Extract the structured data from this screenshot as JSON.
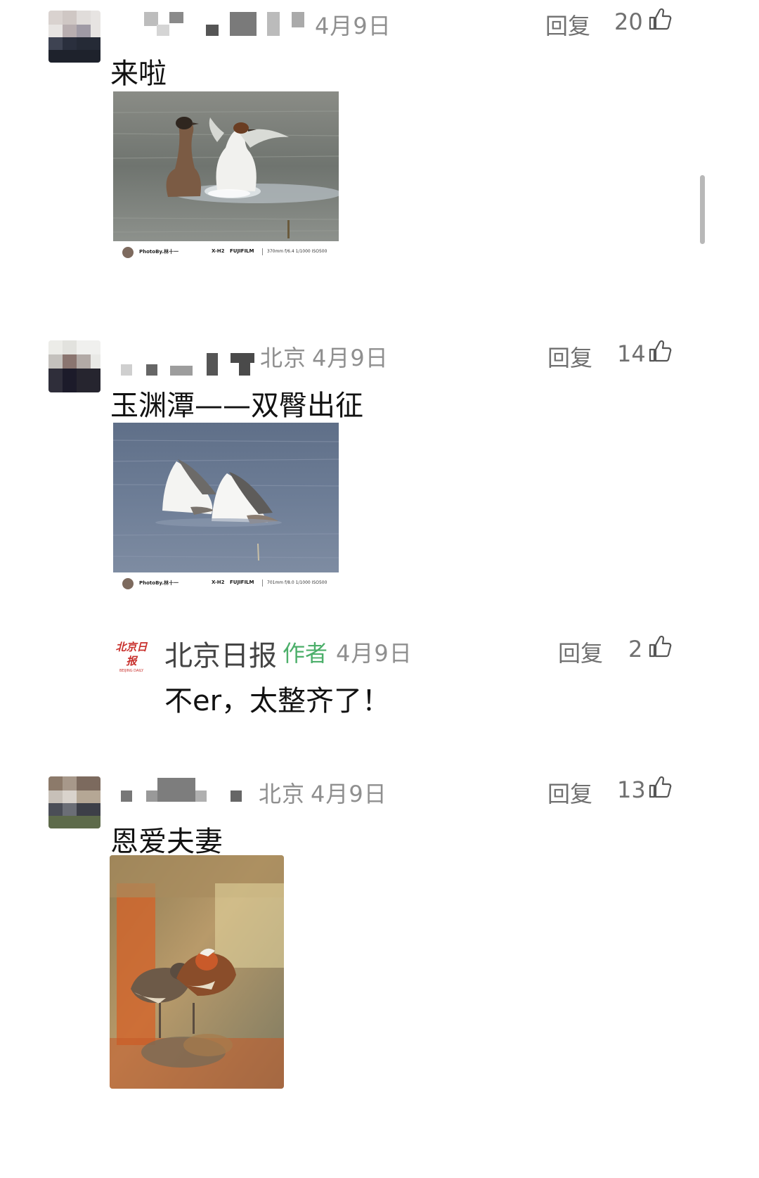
{
  "comments": [
    {
      "date": "4月9日",
      "reply_label": "回复",
      "likes": "20",
      "text": "来啦",
      "photo_footer": {
        "credit": "PhotoBy.林十一",
        "camera": "X-H2",
        "brand": "FUJIFILM",
        "exif": "370mm f/6.4 1/1000 ISO500"
      }
    },
    {
      "location": "北京",
      "date": "4月9日",
      "reply_label": "回复",
      "likes": "14",
      "text": "玉渊潭——双臀出征",
      "photo_footer": {
        "credit": "PhotoBy.林十一",
        "camera": "X-H2",
        "brand": "FUJIFILM",
        "exif": "701mm f/8.0 1/1000 ISO500"
      }
    },
    {
      "location": "北京",
      "date": "4月9日",
      "reply_label": "回复",
      "likes": "13",
      "text": "恩爱夫妻"
    }
  ],
  "author_reply": {
    "logo_text": "北京日报",
    "logo_subtext": "BEIJING DAILY",
    "name": "北京日报",
    "tag": "作者",
    "date": "4月9日",
    "reply_label": "回复",
    "likes": "2",
    "text": "不er，太整齐了！"
  },
  "colors": {
    "tag_green": "#4caf6a",
    "meta_gray": "#8f8f8f",
    "logo_red": "#c8302c"
  }
}
